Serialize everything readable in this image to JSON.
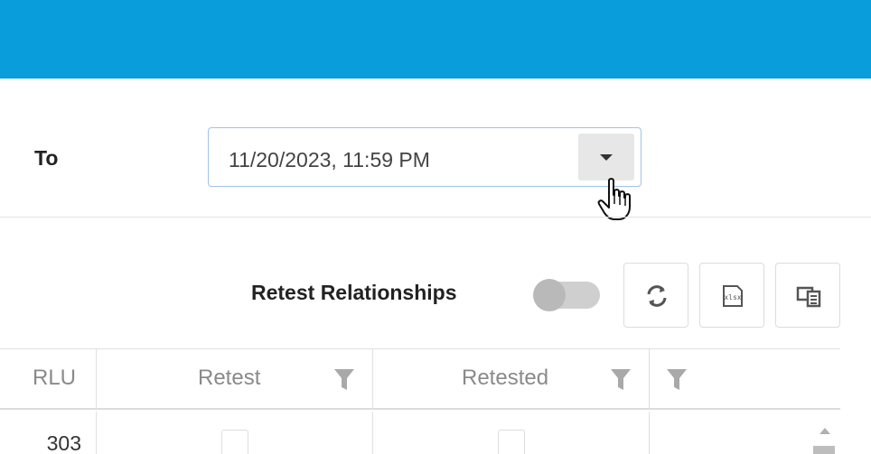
{
  "filter": {
    "to_label": "To",
    "to_value": "11/20/2023, 11:59 PM"
  },
  "toolbar": {
    "retest_relationships_label": "Retest Relationships",
    "retest_relationships_enabled": false,
    "icons": [
      "refresh-icon",
      "xlsx-export-icon",
      "column-chooser-icon"
    ],
    "xlsx_icon_text": "xlsx"
  },
  "grid": {
    "columns": [
      {
        "label": "RLU",
        "filterable": false
      },
      {
        "label": "Retest",
        "filterable": true
      },
      {
        "label": "Retested",
        "filterable": true
      },
      {
        "label": "",
        "filterable": true
      }
    ],
    "rows": [
      {
        "rlu": "303",
        "retest": false,
        "retested": false
      }
    ]
  },
  "colors": {
    "header_bar": "#0a9ddb",
    "field_border": "#9fc3e8"
  }
}
